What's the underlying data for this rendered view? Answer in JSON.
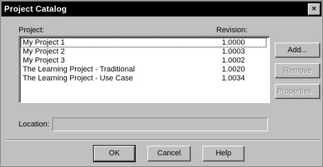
{
  "window": {
    "title": "Project Catalog",
    "close_glyph": "×"
  },
  "list": {
    "header_project": "Project:",
    "header_revision": "Revision:",
    "items": [
      {
        "name": "My Project 1",
        "revision": "1.0000"
      },
      {
        "name": "My Project 2",
        "revision": "1.0003"
      },
      {
        "name": "My Project 3",
        "revision": "1.0002"
      },
      {
        "name": "The Learning Project - Traditional",
        "revision": "1.0020"
      },
      {
        "name": "The Learning Project - Use Case",
        "revision": "1.0034"
      }
    ]
  },
  "side_buttons": {
    "add": "Add...",
    "remove": "Remove",
    "properties": "Properties..."
  },
  "location": {
    "label": "Location:",
    "value": ""
  },
  "buttons": {
    "ok": "OK",
    "cancel": "Cancel",
    "help": "Help"
  }
}
